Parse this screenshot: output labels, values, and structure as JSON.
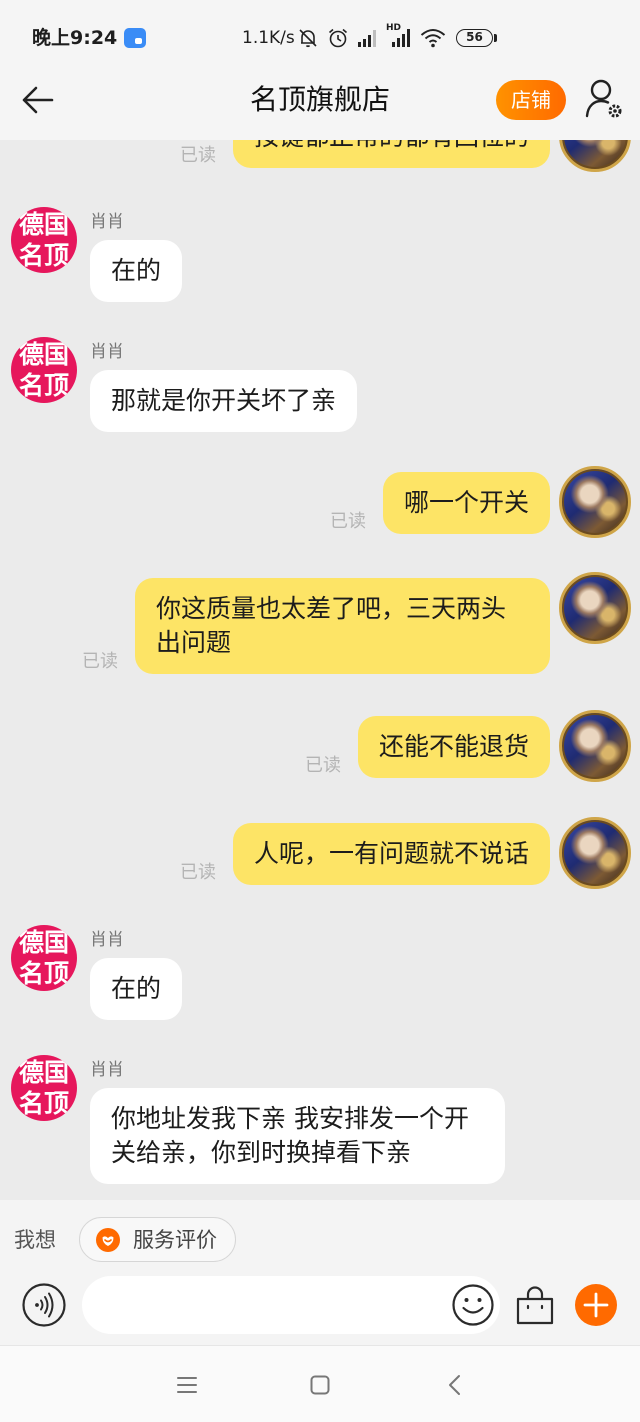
{
  "status_bar": {
    "time": "晚上9:24",
    "net_speed": "1.1K/s",
    "signal_label": "HD",
    "battery_level": "56"
  },
  "header": {
    "title": "名顶旗舰店",
    "shop_button_label": "店铺"
  },
  "seller_avatar_logo": [
    "德国",
    "名顶"
  ],
  "messages": [
    {
      "text": "按键都正常的都有回位的",
      "read": "已读"
    },
    {
      "sender": "肖肖",
      "text": "在的"
    },
    {
      "sender": "肖肖",
      "text": "那就是你开关坏了亲"
    },
    {
      "text": "哪一个开关",
      "read": "已读"
    },
    {
      "text": "你这质量也太差了吧，三天两头出问题",
      "read": "已读"
    },
    {
      "text": "还能不能退货",
      "read": "已读"
    },
    {
      "text": "人呢，一有问题就不说话",
      "read": "已读"
    },
    {
      "sender": "肖肖",
      "text": "在的"
    },
    {
      "sender": "肖肖",
      "text": "你地址发我下亲 我安排发一个开关给亲，你到时换掉看下亲"
    }
  ],
  "quick_actions": {
    "prompt": "我想",
    "chips": [
      {
        "label": "服务评价",
        "icon": "service-rating-icon"
      }
    ]
  },
  "composer": {
    "value": "",
    "placeholder": ""
  },
  "icons": {
    "status_bar": [
      "app-notification-icon",
      "mute-icon",
      "alarm-icon",
      "signal-icon",
      "hd-signal-icon",
      "wifi-icon",
      "battery-icon"
    ],
    "header": [
      "back-arrow-icon",
      "user-settings-icon"
    ],
    "composer": [
      "voice-icon",
      "emoji-icon",
      "shopping-bag-icon",
      "plus-icon"
    ],
    "nav_bar": [
      "recent-apps-icon",
      "home-icon",
      "back-icon"
    ]
  },
  "colors": {
    "top_bg": "#f5f5f5",
    "chat_bg": "#ebebeb",
    "panel_bg": "#f4f4f4",
    "bubble_mine": "#fde466",
    "bubble_theirs": "#ffffff",
    "accent": "#ff6a00",
    "seller_avatar": "#e6175c",
    "read_gray": "#b4b4b4"
  }
}
